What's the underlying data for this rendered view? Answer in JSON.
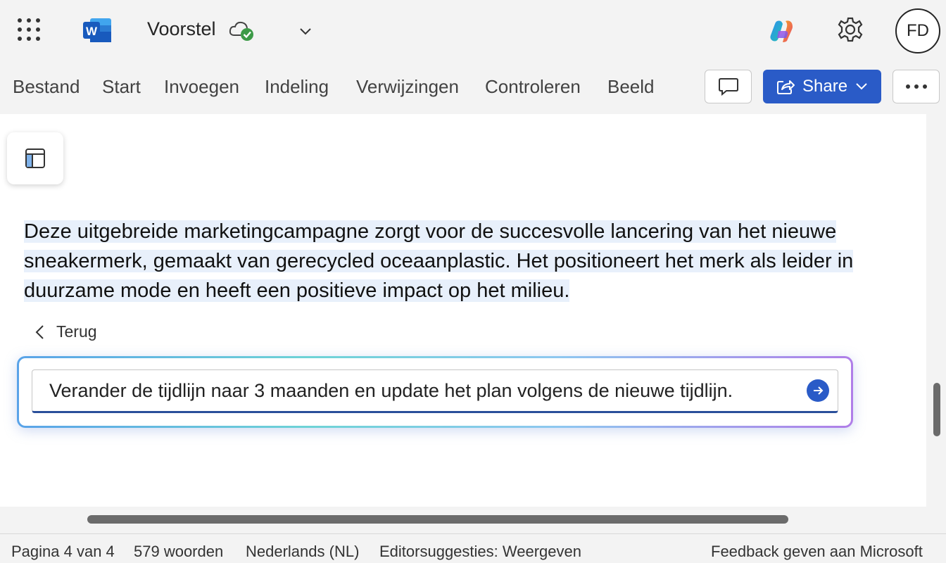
{
  "titlebar": {
    "doc_title": "Voorstel",
    "avatar_initials": "FD",
    "word_logo_letter": "W"
  },
  "menu": {
    "items": [
      "Bestand",
      "Start",
      "Invoegen",
      "Indeling",
      "Verwijzingen",
      "Controleren",
      "Beeld"
    ],
    "share_label": "Share"
  },
  "document": {
    "paragraph": "Deze uitgebreide marketingcampagne zorgt voor de succesvolle lancering van het nieuwe sneakermerk, gemaakt van gerecycled oceaanplastic. Het positioneert het merk als leider in duurzame mode en heeft een positieve impact op het milieu.",
    "back_label": "Terug",
    "prompt_value": "Verander de tijdlijn naar 3 maanden en update het plan volgens de nieuwe tijdlijn."
  },
  "status": {
    "page": "Pagina 4 van 4",
    "words": "579 woorden",
    "language": "Nederlands (NL)",
    "editor": "Editorsuggesties: Weergeven",
    "feedback": "Feedback geven aan Microsoft"
  },
  "colors": {
    "accent": "#2a5bc7",
    "highlight": "#e8f0fb",
    "chrome": "#f3f3f3"
  },
  "icons": [
    "app-launcher-icon",
    "word-logo-icon",
    "cloud-saved-icon",
    "chevron-down-icon",
    "copilot-icon",
    "gear-icon",
    "comment-icon",
    "share-icon",
    "more-icon",
    "navigation-pane-icon",
    "back-chevron-icon",
    "send-arrow-icon"
  ]
}
